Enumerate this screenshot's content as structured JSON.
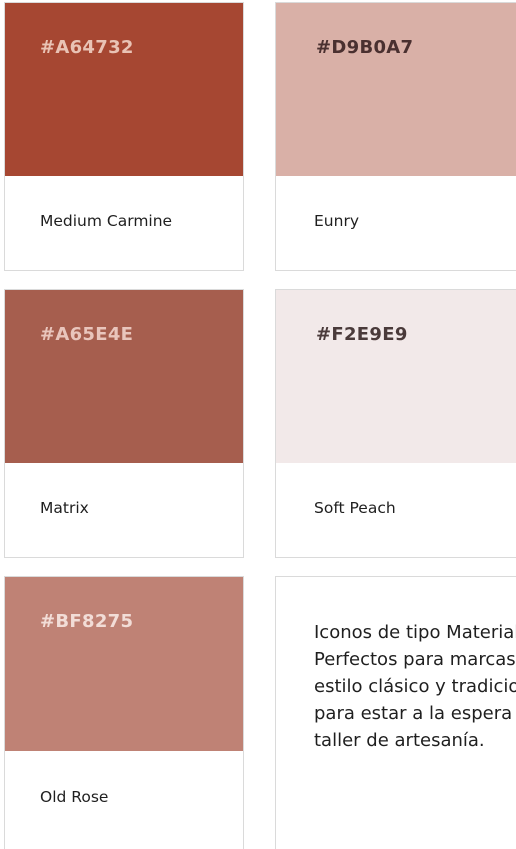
{
  "colors": [
    {
      "hex": "#A64732",
      "name": "Medium Carmine",
      "label_color": "#E9C3B5"
    },
    {
      "hex": "#D9B0A7",
      "name": "Eunry",
      "label_color": "#4A3030"
    },
    {
      "hex": "#A65E4E",
      "name": "Matrix",
      "label_color": "#E9C5BC"
    },
    {
      "hex": "#F2E9E9",
      "name": "Soft Peach",
      "label_color": "#4A3A3A"
    },
    {
      "hex": "#BF8275",
      "name": "Old Rose",
      "label_color": "#F2DDD7"
    }
  ],
  "description": "Iconos de tipo Material. Perfectos para marcas de estilo clásico y tradicional, para estar a la espera de un taller de artesanía."
}
